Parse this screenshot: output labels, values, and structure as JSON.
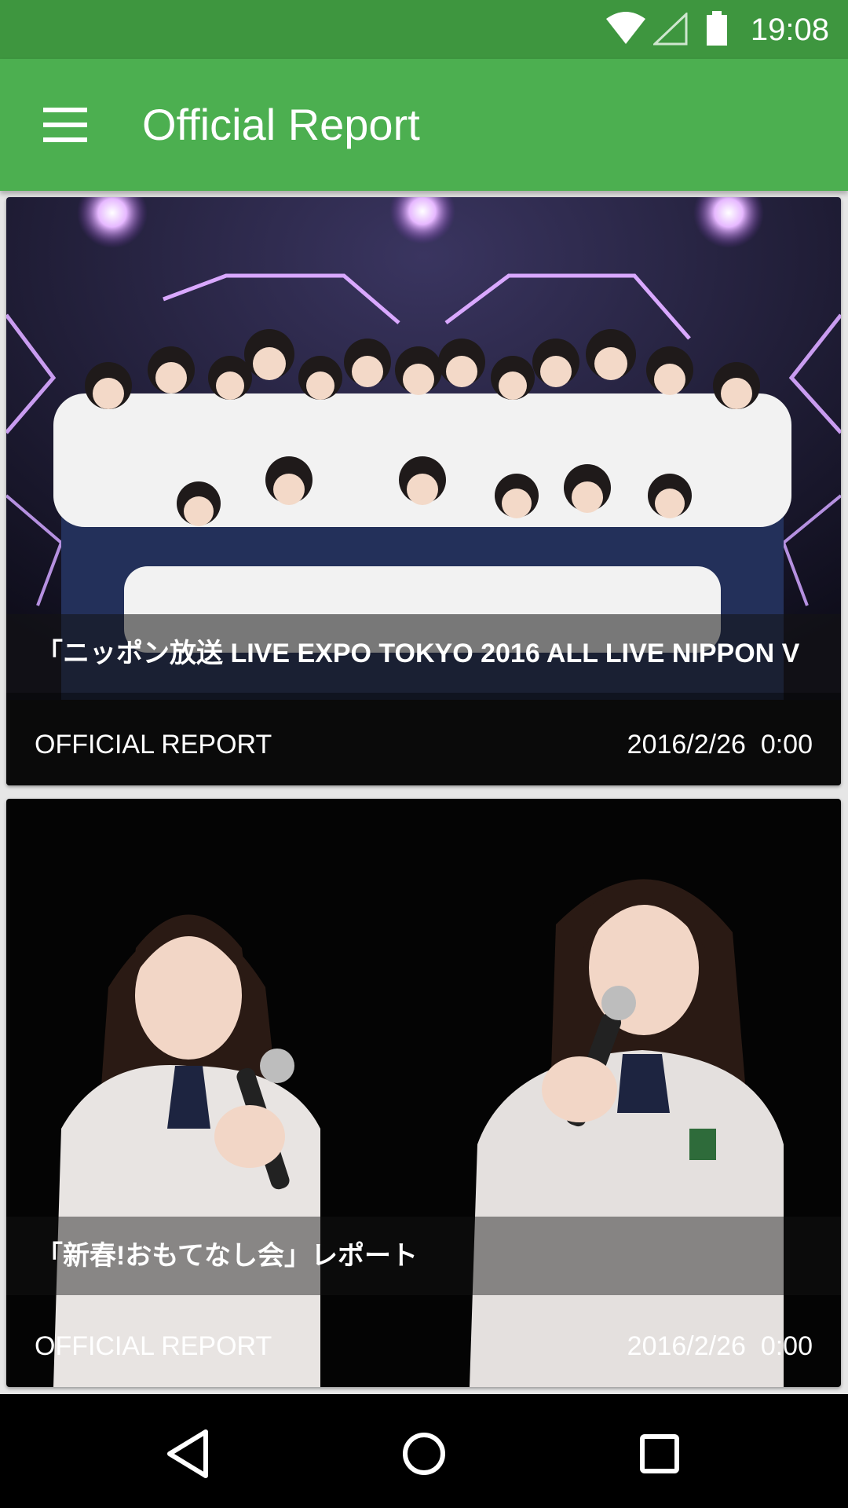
{
  "status_bar": {
    "time": "19:08",
    "icons": [
      "wifi-icon",
      "cell-signal-icon",
      "battery-icon"
    ],
    "color": "#3e963f"
  },
  "app_bar": {
    "title": "Official Report",
    "menu_icon": "hamburger-menu-icon",
    "color": "#4caf50"
  },
  "cards": [
    {
      "headline": "「ニッポン放送 LIVE EXPO TOKYO 2016 ALL LIVE NIPPON V",
      "category": "OFFICIAL REPORT",
      "date": "2016/2/26  0:00",
      "image": "group-on-stage-photo"
    },
    {
      "headline": "「新春!おもてなし会」レポート",
      "category": "OFFICIAL REPORT",
      "date": "2016/2/26  0:00",
      "image": "two-members-with-microphones-photo"
    }
  ],
  "nav_bar": {
    "buttons": [
      "back-icon",
      "home-icon",
      "recents-icon"
    ]
  }
}
